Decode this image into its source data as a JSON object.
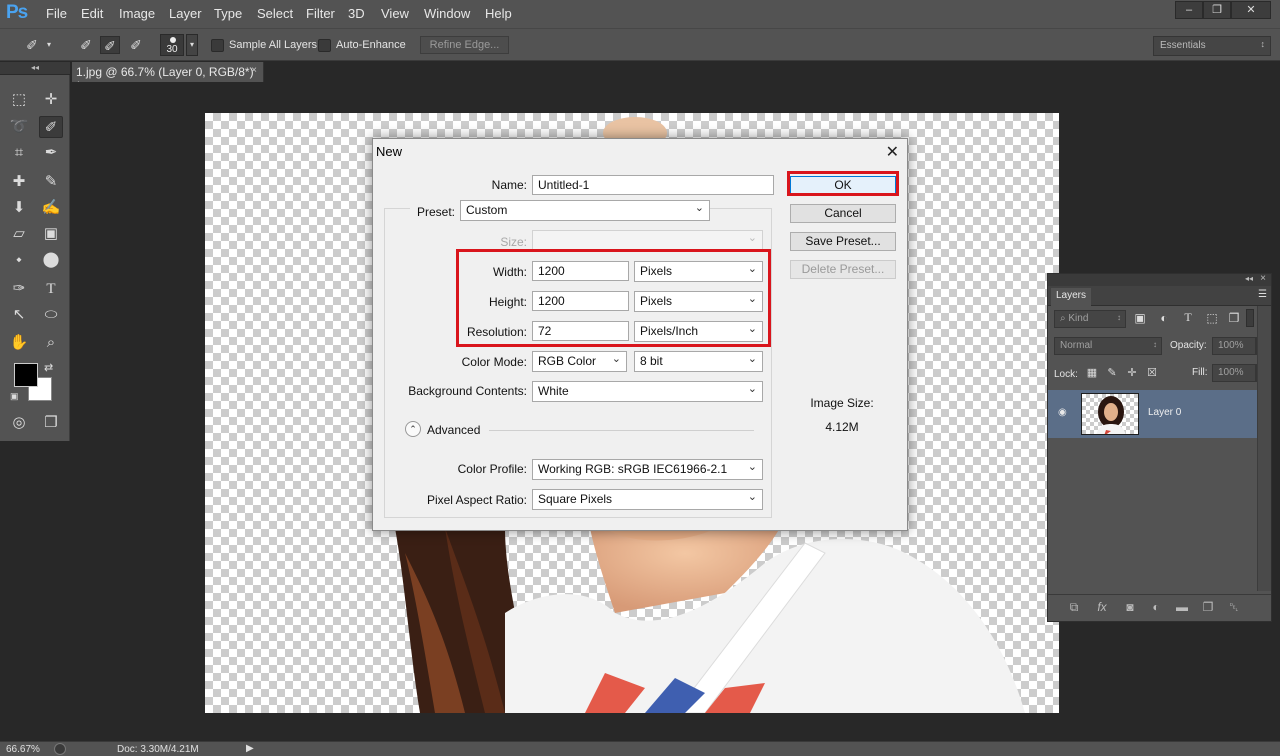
{
  "app": {
    "logo": "Ps",
    "menu": [
      "File",
      "Edit",
      "Image",
      "Layer",
      "Type",
      "Select",
      "Filter",
      "3D",
      "View",
      "Window",
      "Help"
    ],
    "window_controls": [
      "–",
      "❐",
      "✕"
    ]
  },
  "options_bar": {
    "brush_size": "30",
    "sample_all_layers": "Sample All Layers",
    "auto_enhance": "Auto-Enhance",
    "refine_edge": "Refine Edge...",
    "workspace": "Essentials"
  },
  "tools_panel": {
    "collapse": "◂◂"
  },
  "document": {
    "tab_title": "1.jpg @ 66.7% (Layer 0, RGB/8*) *",
    "close": "×"
  },
  "status_bar": {
    "zoom": "66.67%",
    "doc_size": "Doc: 3.30M/4.21M"
  },
  "dialog": {
    "title": "New",
    "name_label": "Name:",
    "name_value": "Untitled-1",
    "preset_label": "Preset:",
    "preset_value": "Custom",
    "size_label": "Size:",
    "size_value": "",
    "width_label": "Width:",
    "width_value": "1200",
    "width_unit": "Pixels",
    "height_label": "Height:",
    "height_value": "1200",
    "height_unit": "Pixels",
    "resolution_label": "Resolution:",
    "resolution_value": "72",
    "resolution_unit": "Pixels/Inch",
    "color_mode_label": "Color Mode:",
    "color_mode_value": "RGB Color",
    "bit_depth_value": "8 bit",
    "background_label": "Background Contents:",
    "background_value": "White",
    "advanced_label": "Advanced",
    "color_profile_label": "Color Profile:",
    "color_profile_value": "Working RGB:  sRGB IEC61966-2.1",
    "aspect_label": "Pixel Aspect Ratio:",
    "aspect_value": "Square Pixels",
    "buttons": {
      "ok": "OK",
      "cancel": "Cancel",
      "save_preset": "Save Preset...",
      "delete_preset": "Delete Preset..."
    },
    "image_size_label": "Image Size:",
    "image_size_value": "4.12M",
    "highlight_color": "#d9151c"
  },
  "layers_panel": {
    "collapse": "◂◂",
    "close": "×",
    "tab": "Layers",
    "filter_kind": "Kind",
    "blend_mode": "Normal",
    "opacity_label": "Opacity:",
    "opacity_value": "100%",
    "lock_label": "Lock:",
    "fill_label": "Fill:",
    "fill_value": "100%",
    "layer_name": "Layer 0",
    "selected_row_color": "#5b6e88"
  }
}
